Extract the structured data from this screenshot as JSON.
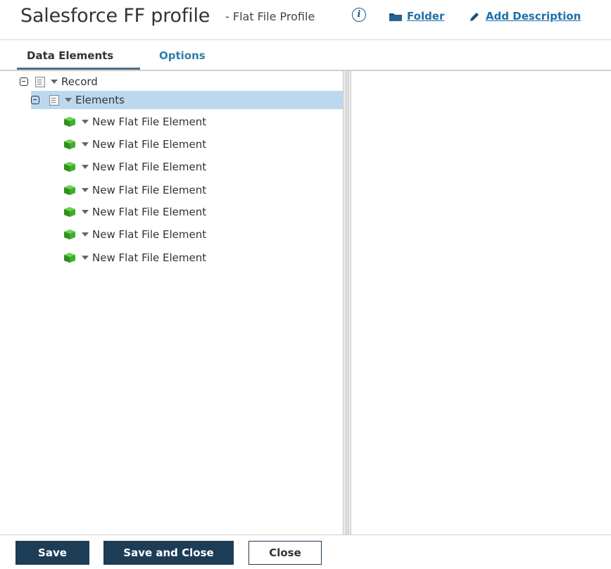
{
  "header": {
    "title": "Salesforce FF profile",
    "subtitle": "- Flat File Profile",
    "info_icon": "info-icon",
    "folder_label": "Folder",
    "add_description_label": "Add Description"
  },
  "tabs": [
    {
      "label": "Data Elements",
      "active": true
    },
    {
      "label": "Options",
      "active": false
    }
  ],
  "tree": {
    "root": {
      "label": "Record",
      "expanded": true
    },
    "group": {
      "label": "Elements",
      "expanded": true,
      "selected": true
    },
    "elements": [
      {
        "label": "New Flat File Element"
      },
      {
        "label": "New Flat File Element"
      },
      {
        "label": "New Flat File Element"
      },
      {
        "label": "New Flat File Element"
      },
      {
        "label": "New Flat File Element"
      },
      {
        "label": "New Flat File Element"
      },
      {
        "label": "New Flat File Element"
      }
    ]
  },
  "footer": {
    "save_label": "Save",
    "save_close_label": "Save and Close",
    "close_label": "Close"
  },
  "colors": {
    "primary_button": "#1d3c56",
    "link": "#1f6fa8",
    "selection": "#bcd8f0",
    "element_icon": "#3fae2a"
  }
}
